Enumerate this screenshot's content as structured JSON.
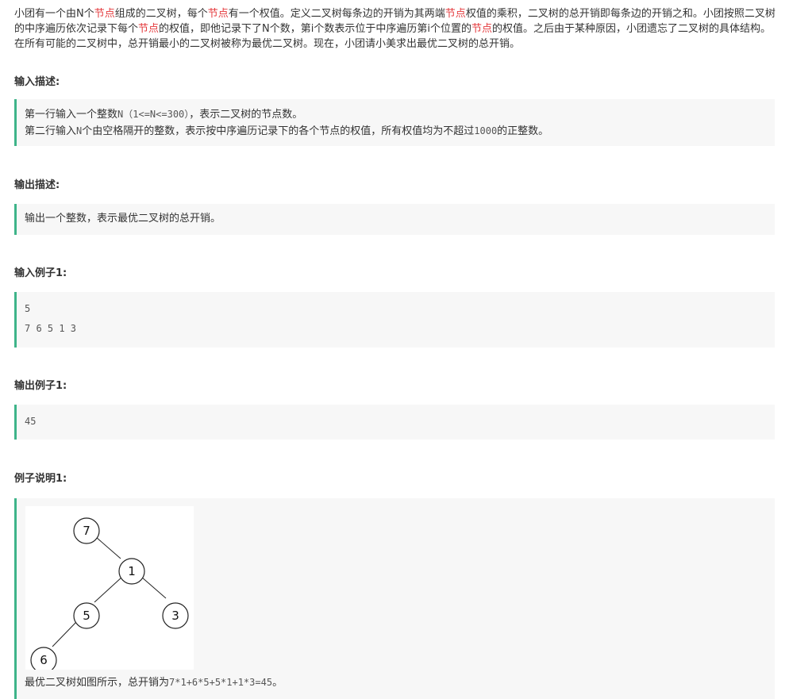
{
  "intro": {
    "p1": "小团有一个由N个",
    "hl1": "节点",
    "p2": "组成的二叉树，每个",
    "hl2": "节点",
    "p3": "有一个权值。定义二叉树每条边的开销为其两端",
    "hl3": "节点",
    "p4": "权值的乘积，二叉树的总开销即每条边的开销之和。小团按照二叉树的中序遍历依次记录下每个",
    "hl4": "节点",
    "p5": "的权值，即他记录下了N个数，第i个数表示位于中序遍历第i个位置的",
    "hl5": "节点",
    "p6": "的权值。之后由于某种原因，小团遗忘了二叉树的具体结构。在所有可能的二叉树中，总开销最小的二叉树被称为最优二叉树。现在，小团请小美求出最优二叉树的总开销。"
  },
  "input_desc": {
    "title": "输入描述:",
    "l1_a": "第一行输入一个整数",
    "l1_code": "N（1<=N<=300）",
    "l1_b": "，表示二叉树的节点数。",
    "l2_a": "第二行输入",
    "l2_code1": "N",
    "l2_b": "个由空格隔开的整数，表示按中序遍历记录下的各个节点的权值，所有权值均为不超过",
    "l2_code2": "1000",
    "l2_c": "的正整数。"
  },
  "output_desc": {
    "title": "输出描述:",
    "text": "输出一个整数，表示最优二叉树的总开销。"
  },
  "input_example": {
    "title": "输入例子1:",
    "line1": "5",
    "line2": "7 6 5 1 3"
  },
  "output_example": {
    "title": "输出例子1:",
    "value": "45"
  },
  "explanation": {
    "title": "例子说明1:",
    "tree_nodes": [
      "7",
      "1",
      "5",
      "3",
      "6"
    ],
    "text_a": "最优二叉树如图所示，总开销为",
    "text_code": "7*1+6*5+5*1+1*3=45",
    "text_b": "。"
  }
}
